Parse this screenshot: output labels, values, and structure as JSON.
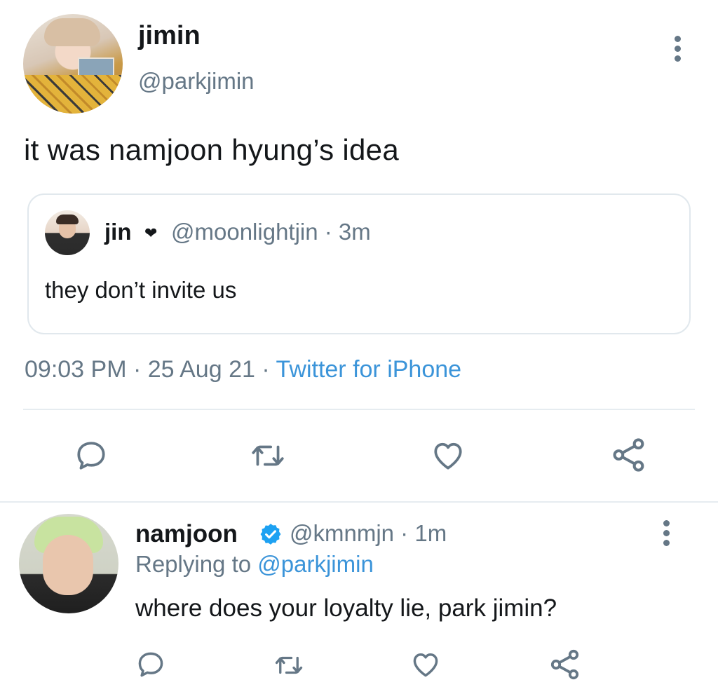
{
  "main_tweet": {
    "display_name": "jimin",
    "handle": "@parkjimin",
    "text": "it was namjoon hyung’s idea",
    "quote": {
      "display_name": "jin",
      "heart": "❤",
      "handle_time": "@moonlightjin · 3m",
      "text": "they don’t invite us"
    },
    "timestamp": "09:03 PM · 25 Aug 21 · ",
    "source": "Twitter for iPhone"
  },
  "reply": {
    "display_name": "namjoon",
    "handle_time": "@kmnmjn · 1m",
    "replying_prefix": "Replying to ",
    "replying_mention": "@parkjimin",
    "text": "where does your loyalty lie, park jimin?"
  },
  "icons": {
    "more": "more-vertical-icon",
    "reply": "reply-icon",
    "retweet": "retweet-icon",
    "like": "heart-icon",
    "share": "share-icon",
    "verified": "verified-badge-icon"
  },
  "colors": {
    "primary_text": "#14171a",
    "secondary_text": "#657786",
    "link": "#3b94d9",
    "divider": "#e6ecf0",
    "verified": "#1da1f2"
  }
}
